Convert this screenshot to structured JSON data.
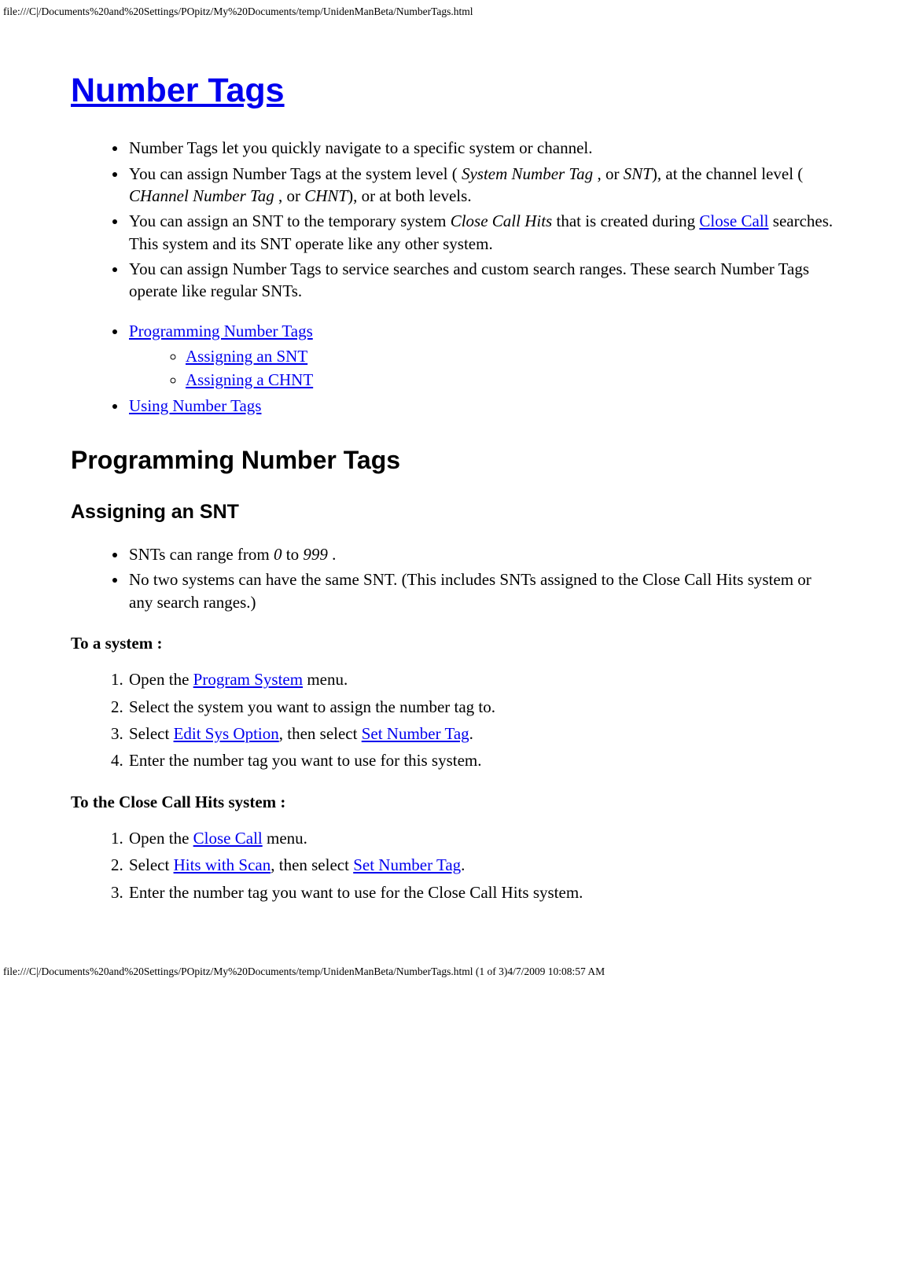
{
  "header_path": "file:///C|/Documents%20and%20Settings/POpitz/My%20Documents/temp/UnidenManBeta/NumberTags.html",
  "footer_path": "file:///C|/Documents%20and%20Settings/POpitz/My%20Documents/temp/UnidenManBeta/NumberTags.html (1 of 3)4/7/2009 10:08:57 AM",
  "title": "Number Tags",
  "intro": {
    "li1": "Number Tags let you quickly navigate to a specific system or channel.",
    "li2_a": "You can assign Number Tags at the system level ( ",
    "li2_b": "System Number Tag ",
    "li2_c": ", or ",
    "li2_d": "SNT",
    "li2_e": "), at the channel level ( ",
    "li2_f": "CHannel Number Tag ",
    "li2_g": ", or ",
    "li2_h": "CHNT",
    "li2_i": "), or at both levels.",
    "li3_a": "You can assign an SNT to the temporary system ",
    "li3_b": "Close Call Hits",
    "li3_c": " that is created during ",
    "li3_link": "Close Call",
    "li3_d": " searches. This system and its SNT operate like any other system.",
    "li4": "You can assign Number Tags to service searches and custom search ranges. These search Number Tags operate like regular SNTs."
  },
  "toc": {
    "l1": "Programming Number Tags",
    "l1a": "Assigning an SNT",
    "l1b": "Assigning a CHNT",
    "l2": "Using Number Tags"
  },
  "h2_prog": "Programming Number Tags",
  "h3_snt": "Assigning an SNT",
  "snt_ul": {
    "li1_a": "SNTs can range from ",
    "li1_b": "0",
    "li1_c": " to ",
    "li1_d": "999 ",
    "li1_e": ".",
    "li2": "No two systems can have the same SNT. (This includes SNTs assigned to the Close Call Hits system or any search ranges.)"
  },
  "to_system_label": "To a system ",
  "colon": ":",
  "to_system": {
    "s1_a": "Open the ",
    "s1_link": "Program System",
    "s1_b": " menu.",
    "s2": "Select the system you want to assign the number tag to.",
    "s3_a": "Select ",
    "s3_link1": "Edit Sys Option",
    "s3_b": ", then select ",
    "s3_link2": "Set Number Tag",
    "s3_c": ".",
    "s4": "Enter the number tag you want to use for this system."
  },
  "to_cc_label": "To the Close Call Hits system ",
  "to_cc": {
    "s1_a": "Open the ",
    "s1_link": "Close Call",
    "s1_b": " menu.",
    "s2_a": "Select ",
    "s2_link1": "Hits with Scan",
    "s2_b": ", then select ",
    "s2_link2": "Set Number Tag",
    "s2_c": ".",
    "s3": "Enter the number tag you want to use for the Close Call Hits system."
  }
}
